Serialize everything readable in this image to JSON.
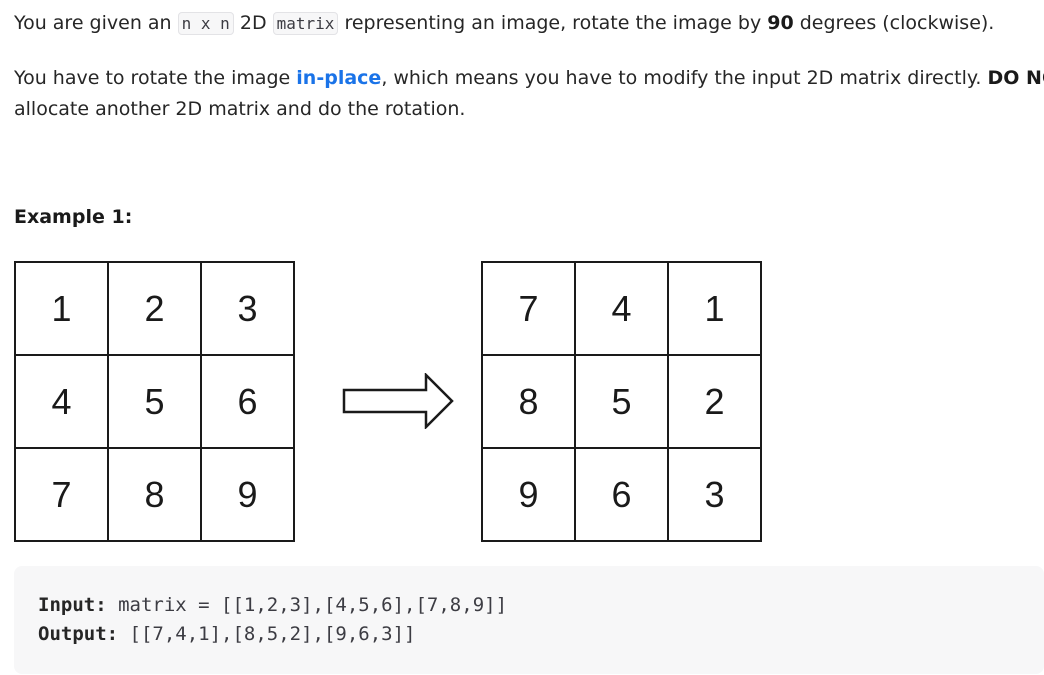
{
  "description": {
    "p1": {
      "t1": "You are given an ",
      "code1": "n x n",
      "t2": " 2D ",
      "code2": "matrix",
      "t3": " representing an image, rotate the image by ",
      "bold1": "90",
      "t4": " degrees (clockwise)."
    },
    "p2": {
      "t1": "You have to rotate the image ",
      "link": "in-place",
      "t2": ", which means you have to modify the input 2D matrix directly. ",
      "bold1": "DO NOT",
      "t3": "allocate another 2D matrix and do the rotation."
    }
  },
  "example": {
    "heading": "Example 1:",
    "input_grid": [
      [
        "1",
        "2",
        "3"
      ],
      [
        "4",
        "5",
        "6"
      ],
      [
        "7",
        "8",
        "9"
      ]
    ],
    "output_grid": [
      [
        "7",
        "4",
        "1"
      ],
      [
        "8",
        "5",
        "2"
      ],
      [
        "9",
        "6",
        "3"
      ]
    ],
    "arrow_icon": "right-arrow-icon",
    "input_label": "Input:",
    "input_text": " matrix = [[1,2,3],[4,5,6],[7,8,9]]",
    "output_label": "Output:",
    "output_text": " [[7,4,1],[8,5,2],[9,6,3]]"
  }
}
